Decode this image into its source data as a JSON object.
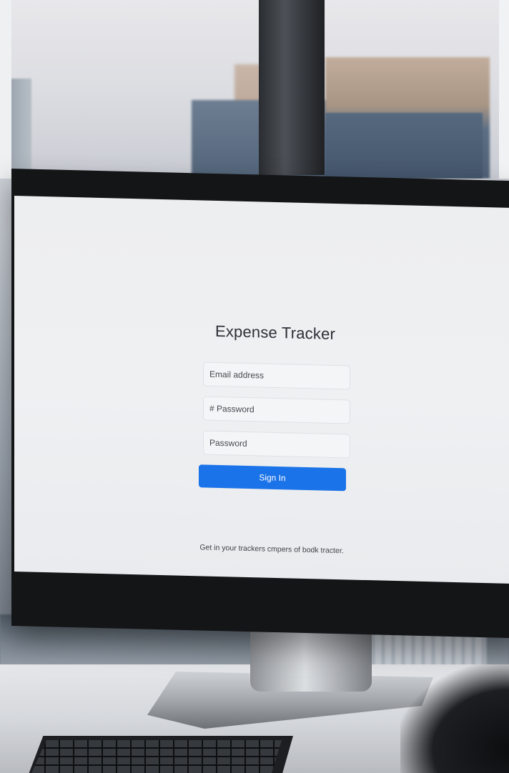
{
  "app": {
    "title": "Expense Tracker"
  },
  "form": {
    "email_placeholder": "Email address",
    "password_placeholder_1": "# Password",
    "password_placeholder_2": "Password",
    "signin_label": "Sign In"
  },
  "footer": {
    "text": "Get in your trackers cmpers of bodk tracter."
  },
  "colors": {
    "accent": "#1a73e8",
    "screen_bg": "#eeeff1",
    "bezel": "#141517"
  }
}
